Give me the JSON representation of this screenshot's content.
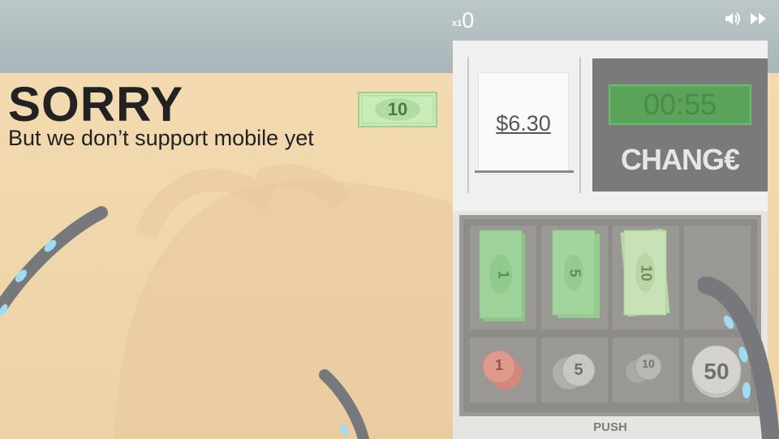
{
  "hud": {
    "multiplier": "x1",
    "score": "0"
  },
  "message": {
    "title": "SORRY",
    "subtitle": "But we don’t support mobile yet"
  },
  "floating_bill": {
    "value": "10"
  },
  "receipt": {
    "amount": "$6.30"
  },
  "change_panel": {
    "timer": "00:55",
    "label": "CHANG€"
  },
  "drawer": {
    "bills": [
      {
        "value": "1",
        "color": "#8fd98f"
      },
      {
        "value": "5",
        "color": "#94db94"
      },
      {
        "value": "10",
        "color": "#c9ecb8"
      },
      {
        "value": "",
        "color": "#8a8a8a"
      }
    ],
    "coins": [
      {
        "value": "1",
        "color": "#e98c7f"
      },
      {
        "value": "5",
        "color": "#c9c9c9"
      },
      {
        "value": "10",
        "color": "#b5b5b5"
      },
      {
        "value": "50",
        "color": "#d9d9d9"
      }
    ],
    "push_label": "PUSH"
  },
  "icons": {
    "sound": "speaker-icon",
    "fast_forward": "fast-forward-icon"
  }
}
